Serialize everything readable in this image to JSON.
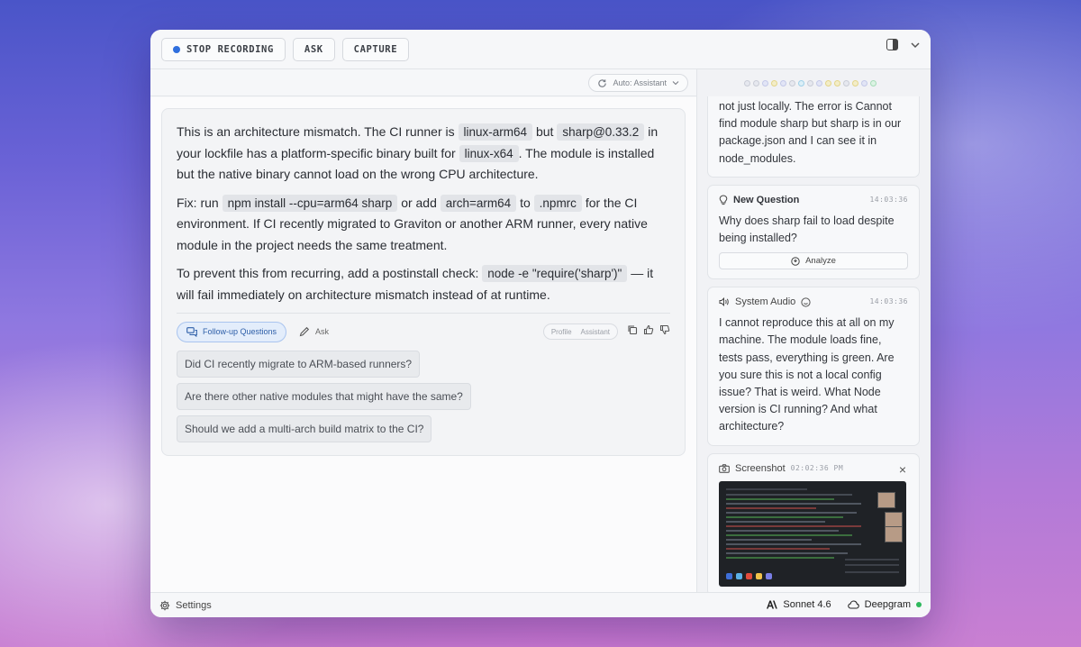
{
  "toolbar": {
    "stop_recording": "STOP RECORDING",
    "ask": "ASK",
    "capture": "CAPTURE"
  },
  "subbar": {
    "mode_selector": "Auto: Assistant"
  },
  "answer": {
    "p1": {
      "t1": "This is an architecture mismatch. The CI runner is",
      "c1": "linux-arm64",
      "t2": "but",
      "c2": "sharp@0.33.2",
      "t3": "in your lockfile has a platform-specific binary built for",
      "c3": "linux-x64",
      "t4": ". The module is installed but the native binary cannot load on the wrong CPU architecture."
    },
    "p2": {
      "t1": "Fix: run",
      "c1": "npm install --cpu=arm64 sharp",
      "t2": "or add",
      "c2": "arch=arm64",
      "t3": "to",
      "c3": ".npmrc",
      "t4": "for the CI environment. If CI recently migrated to Graviton or another ARM runner, every native module in the project needs the same treatment."
    },
    "p3": {
      "t1": "To prevent this from recurring, add a postinstall check:",
      "c1": "node -e \"require('sharp')\"",
      "t2": "— it will fail immediately on architecture mismatch instead of at runtime."
    },
    "actions": {
      "followup": "Follow-up Questions",
      "ask": "Ask",
      "profile_label": "Profile",
      "profile_value": "Assistant"
    },
    "suggestions": [
      "Did CI recently migrate to ARM-based runners?",
      "Are there other native modules that might have the same?",
      "Should we add a multi-arch build matrix to the CI?"
    ]
  },
  "feed": {
    "partial_text": "not just locally. The error is Cannot find module sharp but sharp is in our package.json and I can see it in node_modules.",
    "question": {
      "title": "New Question",
      "time": "14:03:36",
      "text": "Why does sharp fail to load despite being installed?",
      "analyze": "Analyze"
    },
    "audio": {
      "title": "System Audio",
      "time": "14:03:36",
      "text": "I cannot reproduce this at all on my machine. The module loads fine, tests pass, everything is green. Are you sure this is not a local config issue? That is weird. What Node version is CI running? And what architecture?"
    },
    "screenshot": {
      "title": "Screenshot",
      "time": "02:02:36 PM"
    }
  },
  "status": {
    "settings": "Settings",
    "model": "Sonnet 4.6",
    "transcriber": "Deepgram"
  },
  "colors": {
    "accent_blue": "#2f6fde",
    "status_green": "#2eb85c"
  }
}
